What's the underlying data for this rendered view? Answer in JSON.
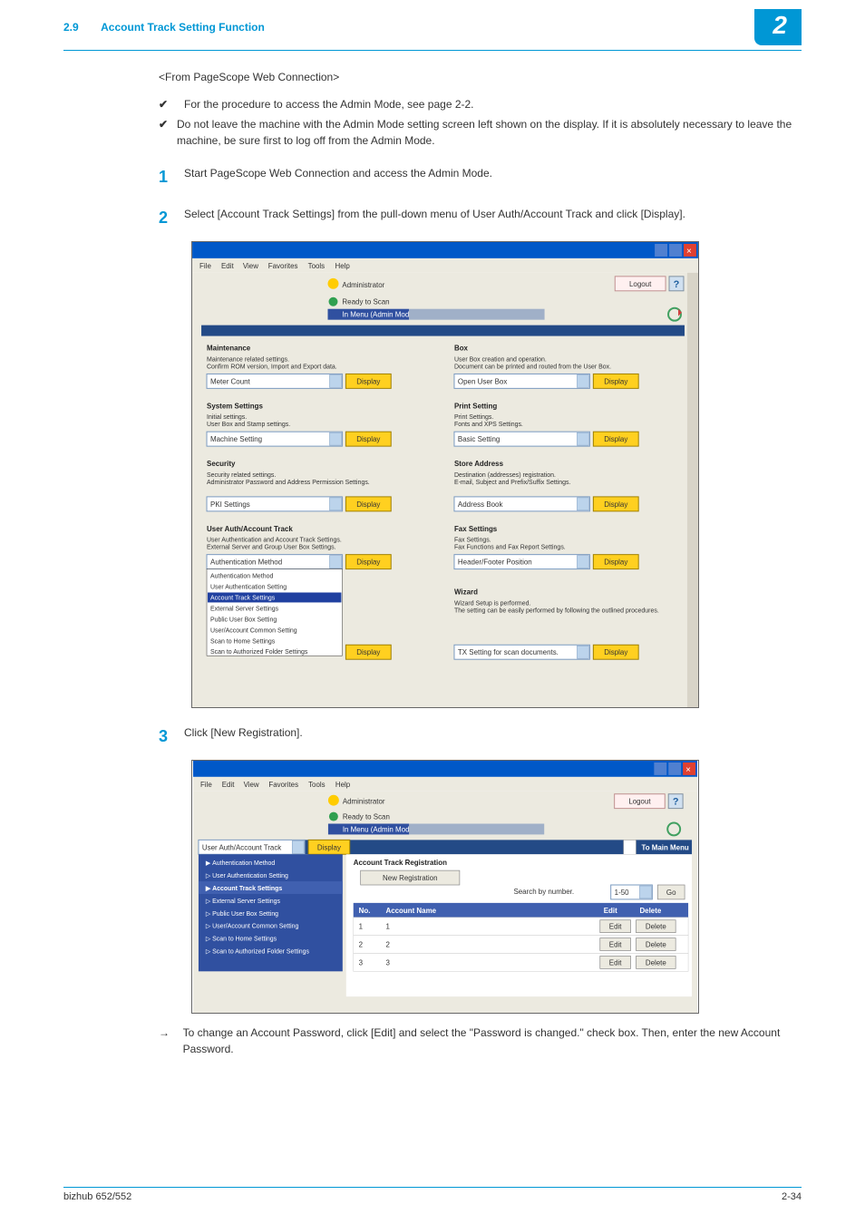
{
  "header": {
    "section_number": "2.9",
    "section_title": "Account Track Setting Function",
    "chapter_badge": "2"
  },
  "intro": {
    "angle_heading": "<From PageScope Web Connection>",
    "check1": "For the procedure to access the Admin Mode, see page 2-2.",
    "check2": "Do not leave the machine with the Admin Mode setting screen left shown on the display. If it is absolutely necessary to leave the machine, be sure first to log off from the Admin Mode."
  },
  "steps": {
    "s1": "Start PageScope Web Connection and access the Admin Mode.",
    "s2": "Select [Account Track Settings] from the pull-down menu of User Auth/Account Track and click [Display].",
    "s3": "Click [New Registration].",
    "arrow": "To change an Account Password, click [Edit] and select the \"Password is changed.\" check box. Then, enter the new Account Password."
  },
  "footer": {
    "left": "bizhub 652/552",
    "right": "2-34"
  },
  "shot1": {
    "menubar": {
      "file": "File",
      "edit": "Edit",
      "view": "View",
      "favorites": "Favorites",
      "tools": "Tools",
      "help": "Help"
    },
    "top": {
      "admin": "Administrator",
      "logout": "Logout",
      "ready": "Ready to Scan",
      "inmenu": "In Menu (Admin Mode)"
    },
    "display": "Display",
    "groups": {
      "maintenance": {
        "title": "Maintenance",
        "desc1": "Maintenance related settings.",
        "desc2": "Confirm ROM version, Import and Export data.",
        "dd": "Meter Count"
      },
      "system": {
        "title": "System Settings",
        "desc1": "Initial settings.",
        "desc2": "User Box and Stamp settings.",
        "dd": "Machine Setting"
      },
      "security": {
        "title": "Security",
        "desc1": "Security related settings.",
        "desc2": "Administrator Password and Address Permission Settings.",
        "dd": "PKI Settings"
      },
      "userauth": {
        "title": "User Auth/Account Track",
        "desc1": "User Authentication and Account Track Settings.",
        "desc2": "External Server and Group User Box Settings.",
        "dd": "Authentication Method",
        "list": [
          "Authentication Method",
          "User Authentication Setting",
          "Account Track Settings",
          "External Server Settings",
          "Public User Box Setting",
          "User/Account Common Setting",
          "Scan to Home Settings",
          "Scan to Authorized Folder Settings"
        ]
      },
      "box": {
        "title": "Box",
        "desc1": "User Box creation and operation.",
        "desc2": "Document can be printed and routed from the User Box.",
        "dd": "Open User Box"
      },
      "print": {
        "title": "Print Setting",
        "desc1": "Print Settings.",
        "desc2": "Fonts and XPS Settings.",
        "dd": "Basic Setting"
      },
      "store": {
        "title": "Store Address",
        "desc1": "Destination (addresses) registration.",
        "desc2": "E-mail, Subject and Prefix/Suffix Settings.",
        "dd": "Address Book"
      },
      "fax": {
        "title": "Fax Settings",
        "desc1": "Fax Settings.",
        "desc2": "Fax Functions and Fax Report Settings.",
        "dd": "Header/Footer Position"
      },
      "wizard": {
        "title": "Wizard",
        "desc1": "Wizard Setup is performed.",
        "desc2": "The setting can be easily performed by following the outlined procedures.",
        "dd": "TX Setting for scan documents."
      }
    }
  },
  "shot2": {
    "menubar": {
      "file": "File",
      "edit": "Edit",
      "view": "View",
      "favorites": "Favorites",
      "tools": "Tools",
      "help": "Help"
    },
    "top": {
      "admin": "Administrator",
      "logout": "Logout",
      "ready": "Ready to Scan",
      "inmenu": "In Menu (Admin Mode)"
    },
    "display": "Display",
    "tomain": "To Main Menu",
    "sidecat": "User Auth/Account Track",
    "sidebar": [
      "Authentication Method",
      "User Authentication Setting",
      "Account Track Settings",
      "External Server Settings",
      "Public User Box Setting",
      "User/Account Common Setting",
      "Scan to Home Settings",
      "Scan to Authorized Folder Settings"
    ],
    "main": {
      "title": "Account Track Registration",
      "newreg": "New Registration",
      "searchlabel": "Search by number.",
      "range": "1-50",
      "go": "Go",
      "cols": {
        "no": "No.",
        "name": "Account Name",
        "edit": "Edit",
        "del": "Delete"
      },
      "rows": [
        {
          "no": "1",
          "name": "1"
        },
        {
          "no": "2",
          "name": "2"
        },
        {
          "no": "3",
          "name": "3"
        }
      ],
      "editbtn": "Edit",
      "delbtn": "Delete"
    }
  }
}
